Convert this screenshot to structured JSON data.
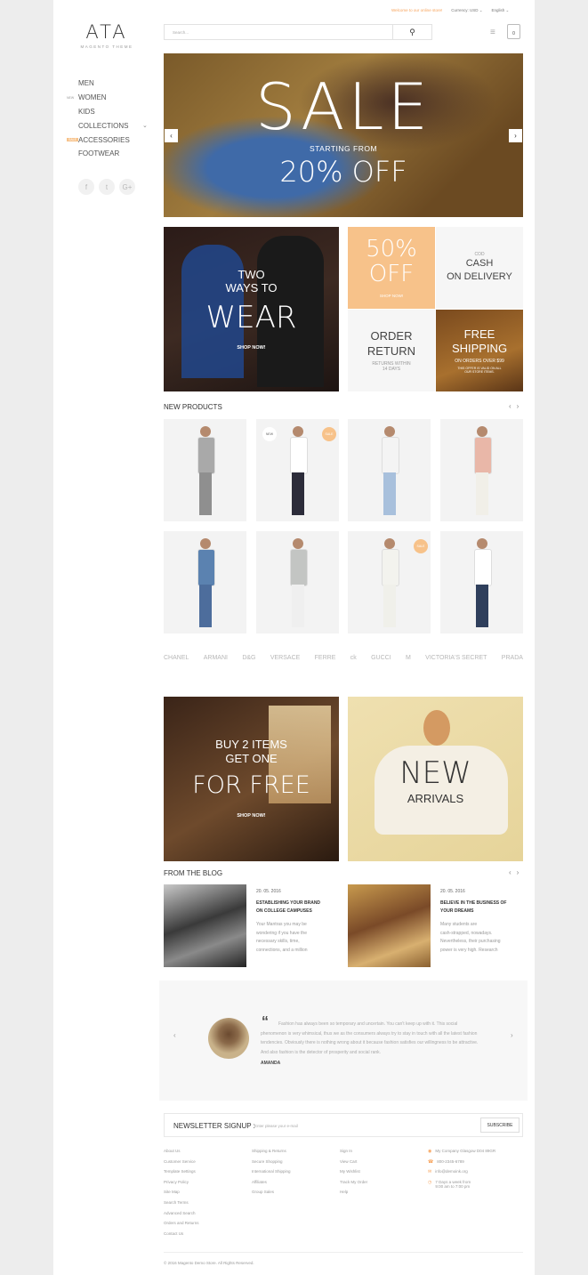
{
  "logo": {
    "title": "ATA",
    "subtitle": "MAGENTO THEME"
  },
  "nav": [
    {
      "label": "MEN",
      "badge": ""
    },
    {
      "label": "WOMEN",
      "badge": "NEW"
    },
    {
      "label": "KIDS",
      "badge": ""
    },
    {
      "label": "COLLECTIONS",
      "badge": ""
    },
    {
      "label": "ACCESSORIES",
      "badge": "SALE"
    },
    {
      "label": "FOOTWEAR",
      "badge": ""
    }
  ],
  "social": {
    "facebook": "f",
    "twitter": "t",
    "google": "G+"
  },
  "topbar": {
    "welcome": "Welcome to our online store!",
    "currency_label": "Currency:",
    "currency_value": "USD",
    "language": "English"
  },
  "search": {
    "placeholder": "Search..."
  },
  "cart": {
    "count": "0"
  },
  "hero": {
    "title": "SALE",
    "starting": "STARTING FROM",
    "discount": "20% OFF"
  },
  "promo_wear": {
    "line1": "TWO",
    "line2": "WAYS TO",
    "line3": "WEAR",
    "cta": "SHOP NOW!"
  },
  "tiles": {
    "fifty": {
      "line1": "50%",
      "line2": "OFF",
      "cta": "SHOP NOW!"
    },
    "cod": {
      "small": "COD",
      "line1": "CASH",
      "line2": "ON DELIVERY"
    },
    "return": {
      "line1": "ORDER",
      "line2": "RETURN",
      "sub1": "RETURNS WITHIN",
      "sub2": "14 DAYS"
    },
    "shipping": {
      "line1": "FREE",
      "line2": "SHIPPING",
      "sub": "ON ORDERS OVER $99",
      "note1": "THIS OFFER IS VALID ON ALL",
      "note2": "OUR STORE ITEMS."
    }
  },
  "new_products": {
    "title": "NEW PRODUCTS",
    "badge_new": "NEW",
    "badge_sale": "SALE"
  },
  "products": [
    {
      "top": "#a9a9a9",
      "bottom": "#8f8f8f",
      "badge": ""
    },
    {
      "top": "#ffffff",
      "bottom": "#2c2c3a",
      "badge": "NEW|SALE"
    },
    {
      "top": "#f4f4f4",
      "bottom": "#a8c0dc",
      "badge": ""
    },
    {
      "top": "#e9b7a8",
      "bottom": "#f1efe8",
      "badge": ""
    },
    {
      "top": "#5b82b0",
      "bottom": "#4d6d9c",
      "badge": ""
    },
    {
      "top": "#c3c5c3",
      "bottom": "#efefef",
      "badge": ""
    },
    {
      "top": "#f3f3ee",
      "bottom": "#f0f0ea",
      "badge": "SALE"
    },
    {
      "top": "#ffffff",
      "bottom": "#2f3f5c",
      "badge": ""
    }
  ],
  "brands": [
    "CHANEL",
    "ARMANI",
    "D&G",
    "VERSACE",
    "FERRE",
    "ck",
    "GUCCI",
    "M",
    "VICTORIA'S SECRET",
    "PRADA"
  ],
  "promo_buy": {
    "line1": "BUY 2 ITEMS",
    "line2": "GET ONE",
    "line3": "FOR FREE",
    "cta": "SHOP NOW!"
  },
  "promo_new": {
    "line1": "NEW",
    "line2": "ARRIVALS"
  },
  "blog": {
    "title": "FROM THE BLOG",
    "posts": [
      {
        "date": "20. 05. 2016",
        "title1": "ESTABLISHING YOUR BRAND",
        "title2": "ON COLLEGE CAMPUSES",
        "ex1": "Your Mantras you may be",
        "ex2": "wondering if you have the",
        "ex3": "necessary skills, time,",
        "ex4": "connections, and a million"
      },
      {
        "date": "20. 05. 2016",
        "title1": "BELIEVE IN THE BUSINESS OF",
        "title2": "YOUR DREAMS",
        "ex1": "Many students are",
        "ex2": "cash-strapped, nowadays.",
        "ex3": "Nevertheless, their purchasing",
        "ex4": "power is very high. Research"
      }
    ]
  },
  "testimonial": {
    "text": "Fashion has always been so temporary and uncertain. You can't keep up with it. This social phenomenon is very whimsical, thus we as the consumers always try to stay in touch with all the latest fashion tendencies. Obviously there is nothing wrong about it because fashion satisfies our willingness to be attractive. And also fashion is the detector of prosperity and social rank.",
    "author": "AMANDA"
  },
  "newsletter": {
    "label": "NEWSLETTER SIGNUP :",
    "placeholder": "Enter please your e-mail",
    "button": "SUBSCRIBE"
  },
  "footer": {
    "col1": [
      "About Us",
      "Customer Service",
      "Template Settings",
      "Privacy Policy",
      "Site Map",
      "Search Terms",
      "Advanced Search",
      "Orders and Returns",
      "Contact Us"
    ],
    "col2": [
      "Shipping & Returns",
      "Secure Shopping",
      "International Shipping",
      "Affiliates",
      "Group Sales"
    ],
    "col3": [
      "Sign In",
      "View Cart",
      "My Wishlist",
      "Track My Order",
      "Help"
    ],
    "contact": {
      "address": "My Company Glasgow D04 89GR",
      "phone": "800-2345-6789",
      "email": "info@demoink.org",
      "hours1": "7 Days a week from",
      "hours2": "9:00 am to 7:00 pm"
    },
    "copyright": "© 2016 Magento Demo Store. All Rights Reserved."
  },
  "colors": {
    "accent": "#f7c28a",
    "accent_text": "#f7a35b"
  }
}
